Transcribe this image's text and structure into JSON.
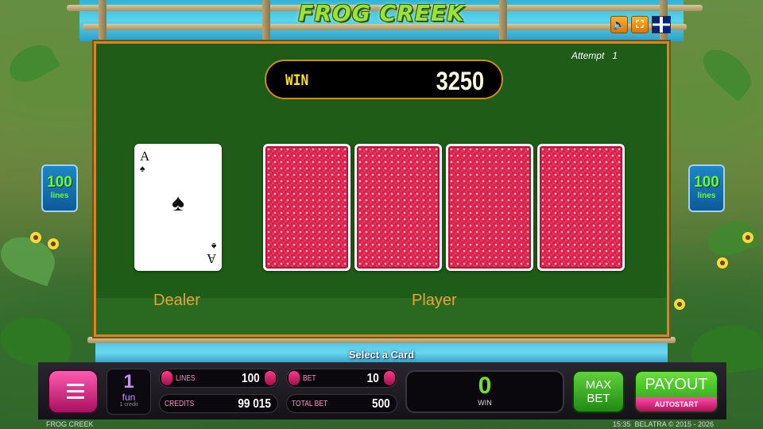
{
  "game": {
    "title": "FROG CREEK",
    "footer_left": "FROG CREEK",
    "footer_time": "15:35",
    "footer_copyright": "BELATRA © 2015 - 2026"
  },
  "top_icons": [
    {
      "name": "sound-icon",
      "glyph": "🔈"
    },
    {
      "name": "fullscreen-icon",
      "glyph": "⛶"
    },
    {
      "name": "language-flag-icon",
      "glyph": ""
    }
  ],
  "table": {
    "attempt_label": "Attempt",
    "attempt_value": "1",
    "win_label": "WIN",
    "win_value": "3250",
    "dealer_label": "Dealer",
    "player_label": "Player",
    "dealer_card": {
      "rank": "A",
      "suit": "♠"
    },
    "player_cards": [
      "face-down",
      "face-down",
      "face-down",
      "face-down"
    ]
  },
  "side_badges": {
    "left_value": "100",
    "left_label": "lines",
    "right_value": "100",
    "right_label": "lines"
  },
  "prompt": "Select a Card",
  "panel": {
    "fun_value": "1",
    "fun_currency": "fun",
    "fun_sub": "1 credit",
    "lines_label": "LINES",
    "lines_value": "100",
    "credits_label": "CREDITS",
    "credits_value": "99 015",
    "bet_label": "BET",
    "bet_value": "10",
    "total_bet_label": "TOTAL BET",
    "total_bet_value": "500",
    "win_value": "0",
    "win_label": "WIN",
    "maxbet_line1": "MAX",
    "maxbet_line2": "BET",
    "payout_label": "PAYOUT",
    "autostart_label": "AUTOSTART"
  },
  "colors": {
    "table_felt": "#1e5c18",
    "table_border": "#c88a2a",
    "card_back": "#d8204a",
    "win_text": "#ffe020",
    "caption": "#e8a23a",
    "panel_accent": "#ff3a8a",
    "button_green": "#5fd23a"
  }
}
